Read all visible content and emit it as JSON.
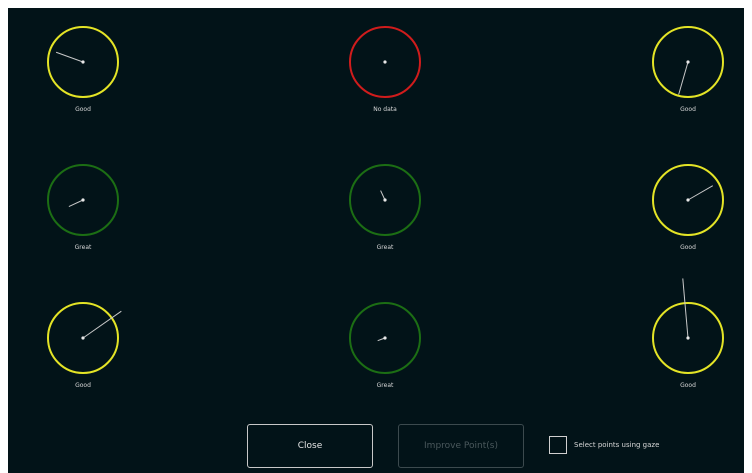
{
  "calibration_points": [
    {
      "id": "top-left",
      "status": "Good",
      "ring_color": "#e4e426",
      "error_angle_deg": 200,
      "error_magnitude": 1.1
    },
    {
      "id": "top-center",
      "status": "No data",
      "ring_color": "#d01c1c",
      "error_angle_deg": 0,
      "error_magnitude": 0
    },
    {
      "id": "top-right",
      "status": "Good",
      "ring_color": "#e4e426",
      "error_angle_deg": 106,
      "error_magnitude": 1.3
    },
    {
      "id": "middle-left",
      "status": "Great",
      "ring_color": "#1c6e14",
      "error_angle_deg": 155,
      "error_magnitude": 0.6
    },
    {
      "id": "middle-center",
      "status": "Great",
      "ring_color": "#1c6e14",
      "error_angle_deg": 245,
      "error_magnitude": 0.4
    },
    {
      "id": "middle-right",
      "status": "Good",
      "ring_color": "#e4e426",
      "error_angle_deg": 330,
      "error_magnitude": 1.1
    },
    {
      "id": "bottom-left",
      "status": "Good",
      "ring_color": "#e4e426",
      "error_angle_deg": 325,
      "error_magnitude": 1.8
    },
    {
      "id": "bottom-center",
      "status": "Great",
      "ring_color": "#1c6e14",
      "error_angle_deg": 160,
      "error_magnitude": 0.3
    },
    {
      "id": "bottom-right",
      "status": "Good",
      "ring_color": "#e4e426",
      "error_angle_deg": 265,
      "error_magnitude": 2.3
    }
  ],
  "buttons": {
    "close_label": "Close",
    "improve_label": "Improve Point(s)",
    "improve_enabled": false
  },
  "gaze_select": {
    "label": "Select points using gaze",
    "checked": false
  },
  "colors": {
    "background": "#021318",
    "good": "#e4e426",
    "great": "#1c6e14",
    "no_data": "#d01c1c",
    "error_line": "#c8c8c8",
    "center_dot": "#e8e8e8"
  }
}
